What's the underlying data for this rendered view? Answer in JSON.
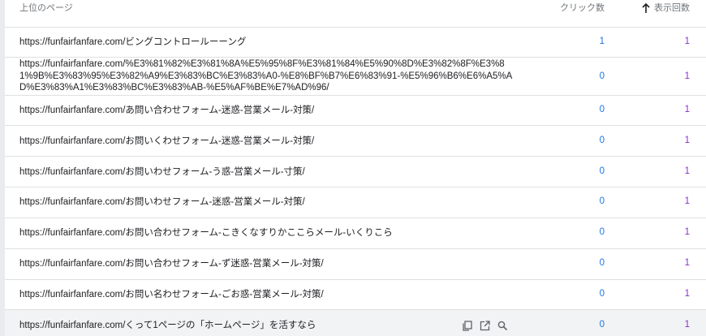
{
  "header": {
    "page_col": "上位のページ",
    "clicks_col": "クリック数",
    "impressions_col": "表示回数",
    "sort_icon": "arrow-up-icon"
  },
  "rows": [
    {
      "url": "https://funfairfanfare.com/ビングコントロールーーング",
      "clicks": "1",
      "impressions": "1"
    },
    {
      "url": "https://funfairfanfare.com/%E3%81%82%E3%81%8A%E5%95%8F%E3%81%84%E5%90%8D%E3%82%8F%E3%81%9B%E3%83%95%E3%82%A9%E3%83%BC%E3%83%A0-%E8%BF%B7%E6%83%91-%E5%96%B6%E6%A5%AD%E3%83%A1%E3%83%BC%E3%83%AB-%E5%AF%BE%E7%AD%96/",
      "clicks": "0",
      "impressions": "1"
    },
    {
      "url": "https://funfairfanfare.com/あ問い合わせフォーム-迷惑-営業メール-対策/",
      "clicks": "0",
      "impressions": "1"
    },
    {
      "url": "https://funfairfanfare.com/お問いくわせフォーム-迷惑-営業メール-対策/",
      "clicks": "0",
      "impressions": "1"
    },
    {
      "url": "https://funfairfanfare.com/お問いわせフォーム-う惑-営業メール-寸策/",
      "clicks": "0",
      "impressions": "1"
    },
    {
      "url": "https://funfairfanfare.com/お問いわせフォーム-迷惑-営業メール-対策/",
      "clicks": "0",
      "impressions": "1"
    },
    {
      "url": "https://funfairfanfare.com/お問い合わせフォーム-こきくなすりかここらメール-いくりこら",
      "clicks": "0",
      "impressions": "1"
    },
    {
      "url": "https://funfairfanfare.com/お問い合わせフォーム-ず迷惑-営業メール-対策/",
      "clicks": "0",
      "impressions": "1"
    },
    {
      "url": "https://funfairfanfare.com/お問い名わせフォーム-ごお惑-営業メール-対策/",
      "clicks": "0",
      "impressions": "1"
    },
    {
      "url": "https://funfairfanfare.com/くって1ページの「ホームページ」を活すなら",
      "clicks": "0",
      "impressions": "1"
    }
  ],
  "row_actions": [
    "copy-icon",
    "open-in-new-icon",
    "search-icon"
  ]
}
